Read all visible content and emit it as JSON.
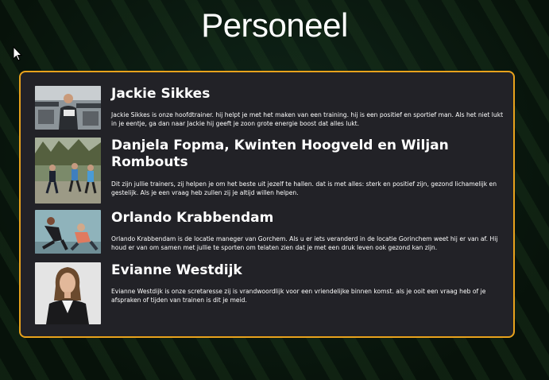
{
  "page": {
    "title": "Personeel"
  },
  "staff": [
    {
      "name": "Jackie Sikkes",
      "photo_icon": "gym-trainer-photo",
      "description": "Jackie Sikkes is onze hoofdtrainer. hij helpt je met het maken van een training. hij is een positief en sportief man. Als het niet lukt in je eentje, ga dan naar Jackie hij geeft je zoon grote energie boost dat alles lukt."
    },
    {
      "name": "Danjela Fopma, Kwinten Hoogveld en Wiljan Rombouts",
      "photo_icon": "runners-photo",
      "description": "Dit zijn jullie trainers, zij helpen je om het beste uit jezelf te hallen. dat is met alles: sterk en positief zijn, gezond lichamelijk en gestelijk. Als je een vraag heb zullen zij je altijd willen helpen."
    },
    {
      "name": "Orlando Krabbendam",
      "photo_icon": "workout-photo",
      "description": "Orlando Krabbendam is de locatie maneger van Gorchem. Als u er iets veranderd in de locatie Gorinchem weet hij er van af. Hij houd er van om samen met jullie te sporten om telaten zien dat je met een druk leven ook gezond kan zijn."
    },
    {
      "name": "Evianne Westdijk",
      "photo_icon": "receptionist-photo",
      "description": "Evianne Westdijk is onze scretaresse zij is vrandwoordlijk voor een vriendelijke binnen komst. als je ooit een vraag heb of je afspraken of tijden van trainen is dit je meid."
    }
  ],
  "colors": {
    "accent": "#e8a21c",
    "panel": "#222227",
    "background": "#0b1a0e"
  }
}
